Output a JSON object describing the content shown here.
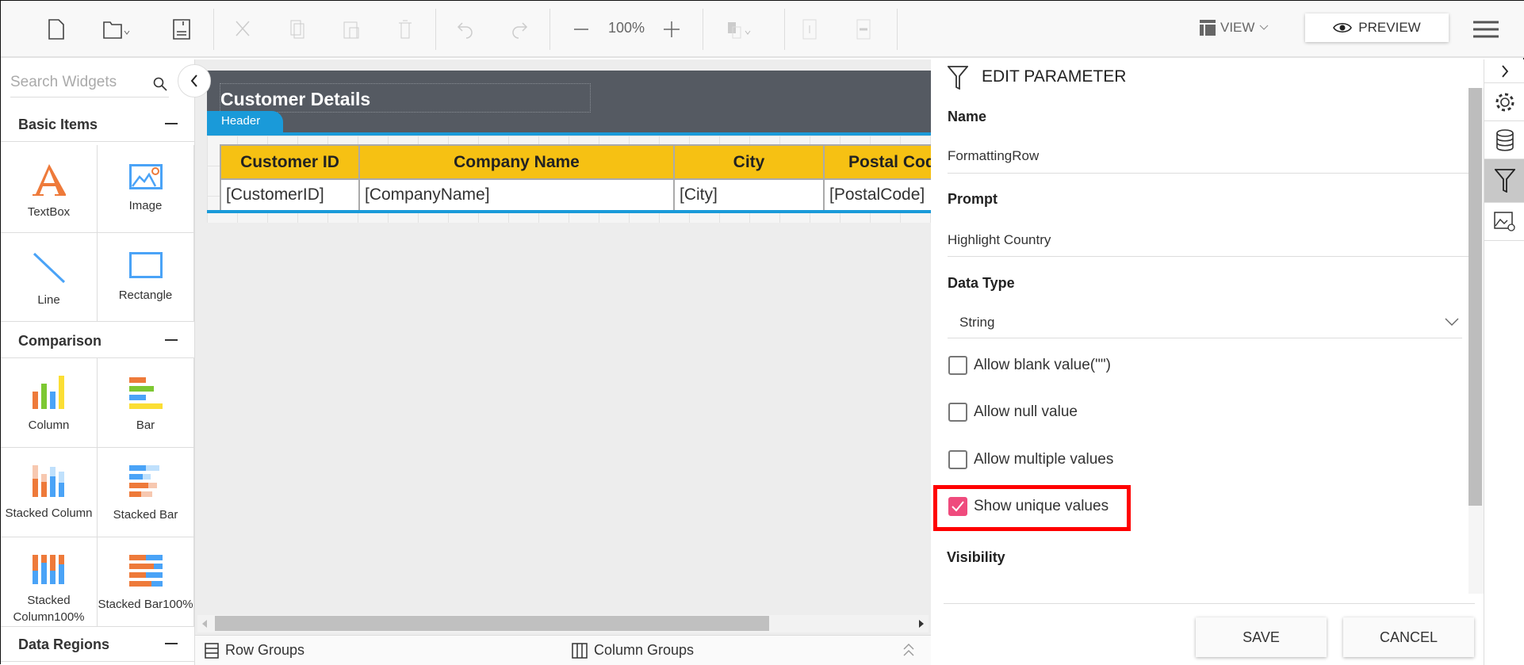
{
  "toolbar": {
    "zoom": "100%",
    "view_label": "VIEW",
    "preview_label": "PREVIEW",
    "icons": [
      "new-file-icon",
      "open-folder-icon",
      "save-icon",
      "cut-icon",
      "copy-icon",
      "paste-icon",
      "delete-icon",
      "undo-icon",
      "redo-icon",
      "zoom-out-icon",
      "zoom-in-icon",
      "align-icon",
      "insert-row-icon",
      "delete-row-icon",
      "view-icon",
      "eye-icon",
      "menu-icon"
    ]
  },
  "sidebar": {
    "search_placeholder": "Search Widgets",
    "sections": [
      {
        "title": "Basic Items",
        "items": [
          {
            "label": "TextBox",
            "icon": "textbox-icon"
          },
          {
            "label": "Image",
            "icon": "image-icon"
          },
          {
            "label": "Line",
            "icon": "line-icon"
          },
          {
            "label": "Rectangle",
            "icon": "rectangle-icon"
          }
        ]
      },
      {
        "title": "Comparison",
        "items": [
          {
            "label": "Column",
            "icon": "column-chart-icon"
          },
          {
            "label": "Bar",
            "icon": "bar-chart-icon"
          },
          {
            "label": "Stacked Column",
            "icon": "stacked-column-icon"
          },
          {
            "label": "Stacked Bar",
            "icon": "stacked-bar-icon"
          },
          {
            "label": "Stacked Column100%",
            "icon": "stacked-column100-icon"
          },
          {
            "label": "Stacked Bar100%",
            "icon": "stacked-bar100-icon"
          }
        ]
      },
      {
        "title": "Data Regions"
      }
    ]
  },
  "report": {
    "title": "Customer Details",
    "header_tab": "Header",
    "columns": [
      "Customer ID",
      "Company Name",
      "City",
      "Postal Code"
    ],
    "row": [
      "[CustomerID]",
      "[CompanyName]",
      "[City]",
      "[PostalCode]"
    ]
  },
  "bottom": {
    "row_groups": "Row Groups",
    "column_groups": "Column Groups"
  },
  "panel": {
    "title": "EDIT PARAMETER",
    "name_label": "Name",
    "name_value": "FormattingRow",
    "prompt_label": "Prompt",
    "prompt_value": "Highlight Country",
    "datatype_label": "Data Type",
    "datatype_value": "String",
    "checkboxes": [
      {
        "label": "Allow blank value(\"\")",
        "checked": false
      },
      {
        "label": "Allow null value",
        "checked": false
      },
      {
        "label": "Allow multiple values",
        "checked": false
      },
      {
        "label": "Show unique values",
        "checked": true
      }
    ],
    "visibility_label": "Visibility",
    "save": "SAVE",
    "cancel": "CANCEL"
  },
  "colors": {
    "accent": "#1a9ad9",
    "header_fill": "#f6c113",
    "checkbox_on": "#ef4b7d",
    "highlight": "#ff0000",
    "band": "#555a62"
  }
}
